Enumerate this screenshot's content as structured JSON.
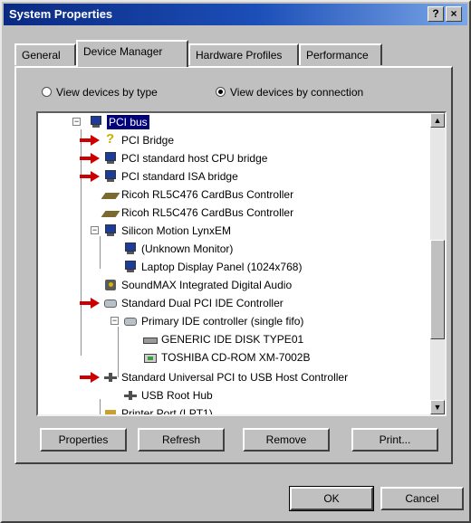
{
  "window": {
    "title": "System Properties",
    "help_button": "?",
    "close_button": "×"
  },
  "tabs": [
    {
      "label": "General",
      "active": false
    },
    {
      "label": "Device Manager",
      "active": true
    },
    {
      "label": "Hardware Profiles",
      "active": false
    },
    {
      "label": "Performance",
      "active": false
    }
  ],
  "view_options": {
    "by_type": {
      "label": "View devices by type",
      "selected": false
    },
    "by_connection": {
      "label": "View devices by connection",
      "selected": true
    }
  },
  "tree": {
    "items": [
      {
        "label": "PCI bus",
        "icon": "monitor-icon",
        "selected": true,
        "expander": "−"
      },
      {
        "label": "PCI Bridge",
        "icon": "question-icon",
        "marked": true
      },
      {
        "label": "PCI standard host CPU bridge",
        "icon": "monitor-icon",
        "marked": true
      },
      {
        "label": "PCI standard ISA bridge",
        "icon": "monitor-icon",
        "marked": true
      },
      {
        "label": "Ricoh RL5C476 CardBus Controller",
        "icon": "card-icon"
      },
      {
        "label": "Ricoh RL5C476 CardBus Controller",
        "icon": "card-icon"
      },
      {
        "label": "Silicon Motion LynxEM",
        "icon": "monitor-icon",
        "expander": "−"
      },
      {
        "label": "(Unknown Monitor)",
        "icon": "monitor-icon"
      },
      {
        "label": "Laptop Display Panel (1024x768)",
        "icon": "monitor-icon"
      },
      {
        "label": "SoundMAX Integrated Digital Audio",
        "icon": "audio-icon"
      },
      {
        "label": "Standard Dual PCI IDE Controller",
        "icon": "ide-controller-icon",
        "marked": true
      },
      {
        "label": "Primary IDE controller (single fifo)",
        "icon": "ide-controller-icon",
        "expander": "−"
      },
      {
        "label": "GENERIC IDE  DISK TYPE01",
        "icon": "disk-drive-icon"
      },
      {
        "label": "TOSHIBA CD-ROM XM-7002B",
        "icon": "cdrom-icon"
      },
      {
        "label": "Standard Universal PCI to USB Host Controller",
        "icon": "usb-icon",
        "marked": true
      },
      {
        "label": "USB Root Hub",
        "icon": "usb-icon"
      },
      {
        "label": "Printer Port (LPT1)",
        "icon": "printer-icon"
      }
    ]
  },
  "buttons": {
    "properties": "Properties",
    "refresh": "Refresh",
    "remove": "Remove",
    "print": "Print...",
    "ok": "OK",
    "cancel": "Cancel"
  },
  "scrollbar": {
    "up": "▲",
    "down": "▼"
  },
  "colors": {
    "title_bar": "#0a2a82",
    "selection": "#00007b",
    "marker_arrow": "#cc0000",
    "face": "#c0c0c0"
  }
}
